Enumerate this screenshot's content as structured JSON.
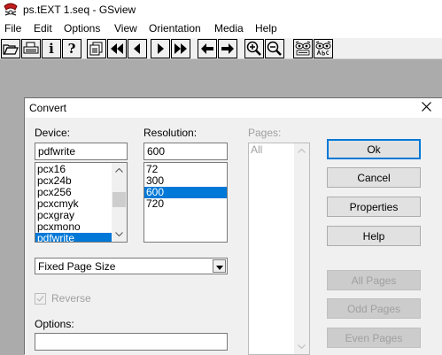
{
  "window": {
    "title": "ps.tEXT 1.seq - GSview",
    "menu": [
      "File",
      "Edit",
      "Options",
      "View",
      "Orientation",
      "Media",
      "Help"
    ]
  },
  "toolbar": {
    "buttons": [
      "open-icon",
      "print-icon",
      "info-letter",
      "help-letter",
      "pages-icon",
      "first-page-icon",
      "previous-page-icon",
      "next-page-icon",
      "last-page-icon",
      "back-icon",
      "forward-icon",
      "zoom-in-icon",
      "zoom-out-icon",
      "display-settings-icon",
      "text-extract-icon"
    ],
    "info_label": "i",
    "help_label": "?"
  },
  "dialog": {
    "title": "Convert",
    "device": {
      "label": "Device:",
      "value": "pdfwrite",
      "items": [
        "pcx16",
        "pcx24b",
        "pcx256",
        "pcxcmyk",
        "pcxgray",
        "pcxmono",
        "pdfwrite"
      ],
      "selected": "pdfwrite"
    },
    "resolution": {
      "label": "Resolution:",
      "value": "600",
      "items": [
        "72",
        "300",
        "600",
        "720"
      ],
      "selected": "600"
    },
    "pages": {
      "label": "Pages:",
      "items": [
        "All"
      ]
    },
    "page_size": {
      "value": "Fixed Page Size"
    },
    "reverse": {
      "label": "Reverse",
      "checked": false
    },
    "options": {
      "label": "Options:",
      "value": ""
    },
    "buttons": {
      "ok": "Ok",
      "cancel": "Cancel",
      "properties": "Properties",
      "help": "Help",
      "all_pages": "All Pages",
      "odd_pages": "Odd Pages",
      "even_pages": "Even Pages"
    }
  },
  "colors": {
    "selection": "#0078d7",
    "workspace": "#ababab",
    "dialog_bg": "#f0f0f0",
    "disabled_text": "#a0a0a0"
  }
}
